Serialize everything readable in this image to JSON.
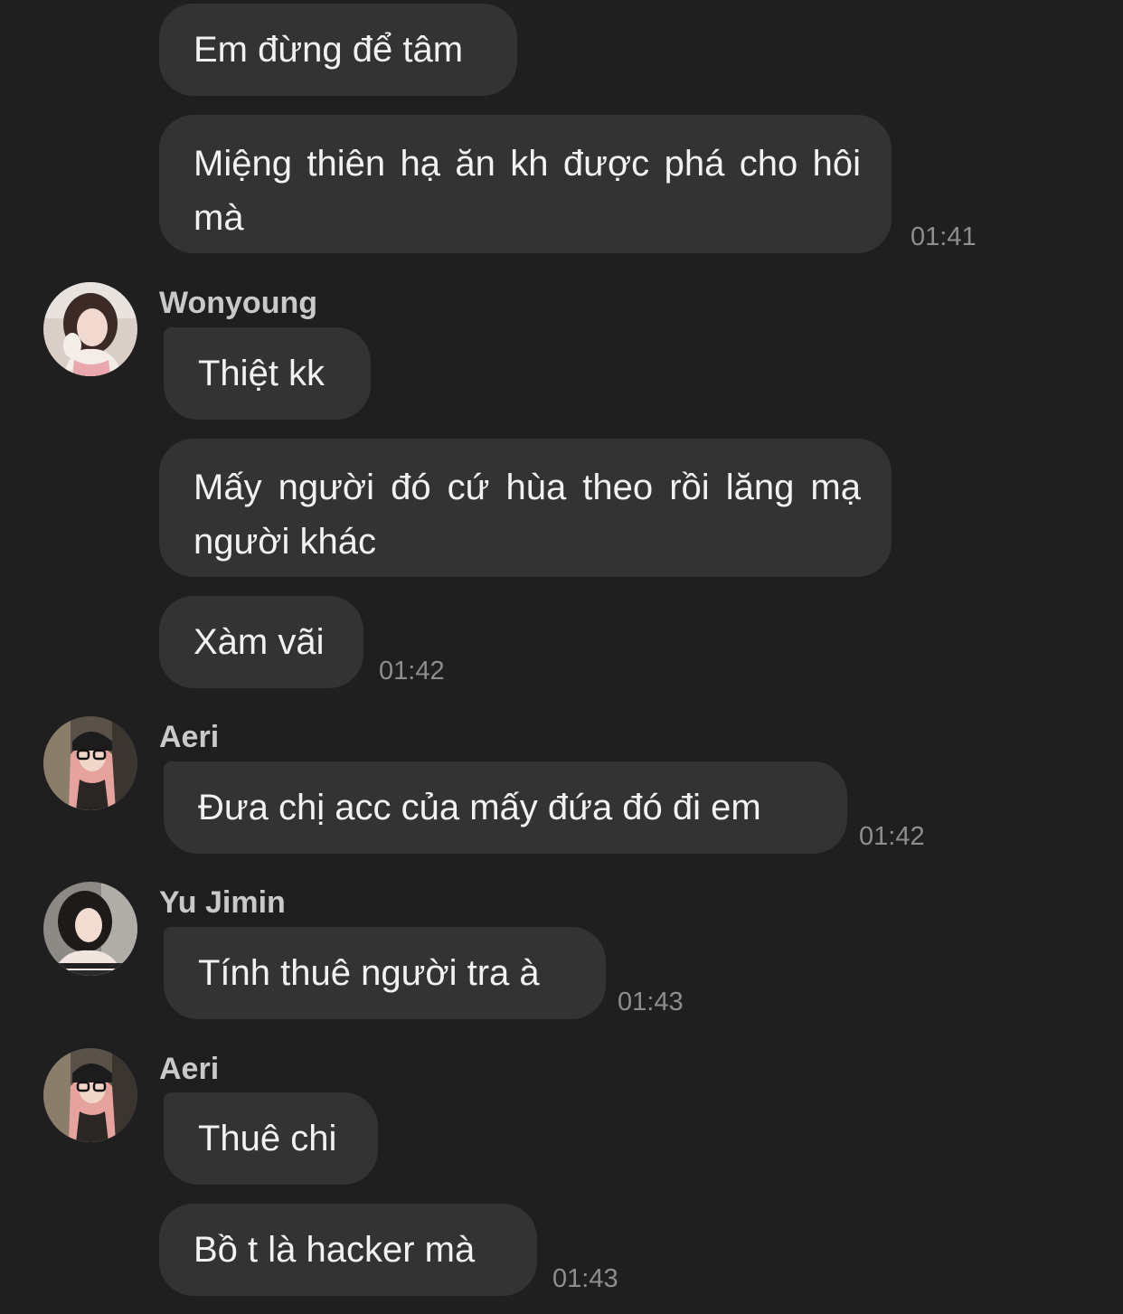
{
  "messages": {
    "m1": "Em đừng để tâm",
    "m2": "Miệng thiên hạ ăn kh được phá cho hôi mà",
    "m2_time": "01:41",
    "wonyoung_name": "Wonyoung",
    "m3": "Thiệt kk",
    "m4": "Mấy người đó cứ hùa theo rồi lăng mạ người khác",
    "m5": "Xàm vãi",
    "m5_time": "01:42",
    "aeri_name_1": "Aeri",
    "m6": "Đưa chị acc của mấy đứa đó đi em",
    "m6_time": "01:42",
    "yujimin_name": "Yu Jimin",
    "m7": "Tính thuê người tra à",
    "m7_time": "01:43",
    "aeri_name_2": "Aeri",
    "m8": "Thuê chi",
    "m9": "Bồ t là hacker mà",
    "m9_time": "01:43"
  },
  "avatars": {
    "wonyoung": "user-avatar-photo",
    "aeri": "user-avatar-photo",
    "yujimin": "user-avatar-photo"
  },
  "colors": {
    "background": "#1f1f1f",
    "bubble": "#333333",
    "text": "#f2f2f2",
    "timestamp": "#8e8e8e",
    "sender_name": "#c9c9c9"
  }
}
